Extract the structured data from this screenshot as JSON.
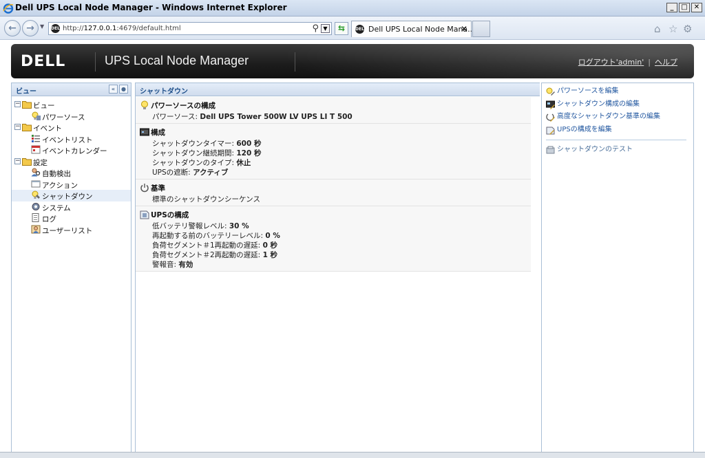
{
  "browser": {
    "window_title": "Dell UPS Local Node Manager - Windows Internet Explorer",
    "url_prefix": "http://",
    "url_host": "127.0.0.1",
    "url_rest": ":4679/default.html",
    "tab_label": "Dell UPS Local Node Mana...",
    "tab_close": "✕",
    "min": "_",
    "max": "□",
    "close": "✕"
  },
  "header": {
    "logo": "DELL",
    "app_title": "UPS Local Node Manager",
    "logout": "ログアウト'admin'",
    "separator": "|",
    "help": "ヘルプ"
  },
  "left": {
    "title": "ビュー",
    "tree": [
      {
        "label": "ビュー",
        "level": 0,
        "expander": "⊟",
        "icon": "folder-icon"
      },
      {
        "label": "パワーソース",
        "level": 1,
        "icon": "power-source-icon"
      },
      {
        "label": "イベント",
        "level": 0,
        "expander": "⊟",
        "icon": "folder-icon"
      },
      {
        "label": "イベントリスト",
        "level": 1,
        "icon": "event-list-icon"
      },
      {
        "label": "イベントカレンダー",
        "level": 1,
        "icon": "event-calendar-icon"
      },
      {
        "label": "設定",
        "level": 0,
        "expander": "⊟",
        "icon": "folder-icon"
      },
      {
        "label": "自動検出",
        "level": 1,
        "icon": "auto-detect-icon"
      },
      {
        "label": "アクション",
        "level": 1,
        "icon": "action-icon"
      },
      {
        "label": "シャットダウン",
        "level": 1,
        "icon": "shutdown-icon",
        "selected": true
      },
      {
        "label": "システム",
        "level": 1,
        "icon": "system-icon"
      },
      {
        "label": "ログ",
        "level": 1,
        "icon": "log-icon"
      },
      {
        "label": "ユーザーリスト",
        "level": 1,
        "icon": "user-list-icon"
      }
    ]
  },
  "center": {
    "title": "シャットダウン",
    "sections": [
      {
        "title": "パワーソースの構成",
        "icon": "lightbulb-icon",
        "lines": [
          {
            "label": "パワーソース: ",
            "value": "Dell UPS Tower 500W LV UPS LI T 500"
          }
        ]
      },
      {
        "title": "構成",
        "icon": "config-icon",
        "lines": [
          {
            "label": "シャットダウンタイマー: ",
            "value": "600 秒"
          },
          {
            "label": "シャットダウン継続期間: ",
            "value": "120 秒"
          },
          {
            "label": "シャットダウンのタイプ: ",
            "value": "休止"
          },
          {
            "label": "UPSの遮断: ",
            "value": "アクティブ"
          }
        ]
      },
      {
        "title": "基準",
        "icon": "power-icon",
        "lines": [
          {
            "label": "標準のシャットダウンシーケンス",
            "value": ""
          }
        ]
      },
      {
        "title": "UPSの構成",
        "icon": "ups-config-icon",
        "lines": [
          {
            "label": "低バッテリ警報レベル: ",
            "value": "30 %"
          },
          {
            "label": "再起動する前のバッテリーレベル: ",
            "value": "0 %"
          },
          {
            "label": "負荷セグメント＃1再起動の遅延: ",
            "value": "0 秒"
          },
          {
            "label": "負荷セグメント＃2再起動の遅延: ",
            "value": "1 秒"
          },
          {
            "label": "警報音: ",
            "value": "有効"
          }
        ]
      }
    ]
  },
  "right": {
    "actions": [
      {
        "label": "パワーソースを編集"
      },
      {
        "label": "シャットダウン構成の編集"
      },
      {
        "label": "高度なシャットダウン基準の編集"
      },
      {
        "label": "UPSの構成を編集"
      }
    ],
    "test": {
      "label": "シャットダウンのテスト"
    }
  }
}
